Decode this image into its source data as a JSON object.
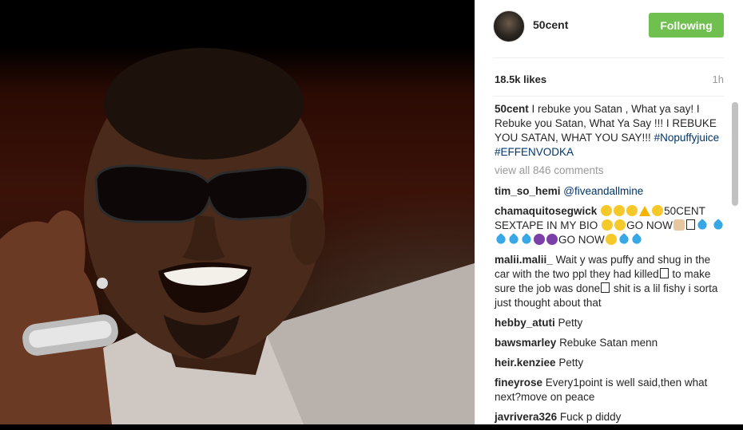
{
  "header": {
    "username": "50cent",
    "follow_label": "Following"
  },
  "stats": {
    "likes": "18.5k likes",
    "time": "1h"
  },
  "caption": {
    "user": "50cent",
    "text": "I rebuke you Satan , What ya say! I Rebuke you Satan, What Ya Say !!! I REBUKE YOU SATAN, WHAT YOU SAY!!!",
    "hashtag1": "#Nopuffyjuice",
    "hashtag2": "#EFFENVODKA"
  },
  "view_all": "view all 846 comments",
  "comments": [
    {
      "user": "tim_so_hemi",
      "mention": "@fiveandallmine"
    },
    {
      "user": "chamaquitosegwick",
      "text_a": "50CENT SEXTAPE IN MY BIO",
      "text_b": "GO NOW",
      "text_c": "GO NOW"
    },
    {
      "user": "malii.malii_",
      "text_a": "Wait y was puffy and shug in the car with the two ppl they had killed",
      "text_b": "to make sure the job was done",
      "text_c": "shit is a lil fishy i sorta just thought about that"
    },
    {
      "user": "hebby_atuti",
      "text": "Petty"
    },
    {
      "user": "bawsmarley",
      "text": "Rebuke Satan menn"
    },
    {
      "user": "heir.kenziee",
      "text": "Petty"
    },
    {
      "user": "fineyrose",
      "text": "Every1point is well said,then what next?move on peace"
    },
    {
      "user": "javrivera326",
      "text": "Fuck p diddy"
    }
  ],
  "icons": {
    "emoji": "emoji-icon",
    "avatar": "avatar"
  },
  "colors": {
    "follow_button": "#70c050",
    "hashtag": "#003569",
    "muted": "#999999"
  }
}
